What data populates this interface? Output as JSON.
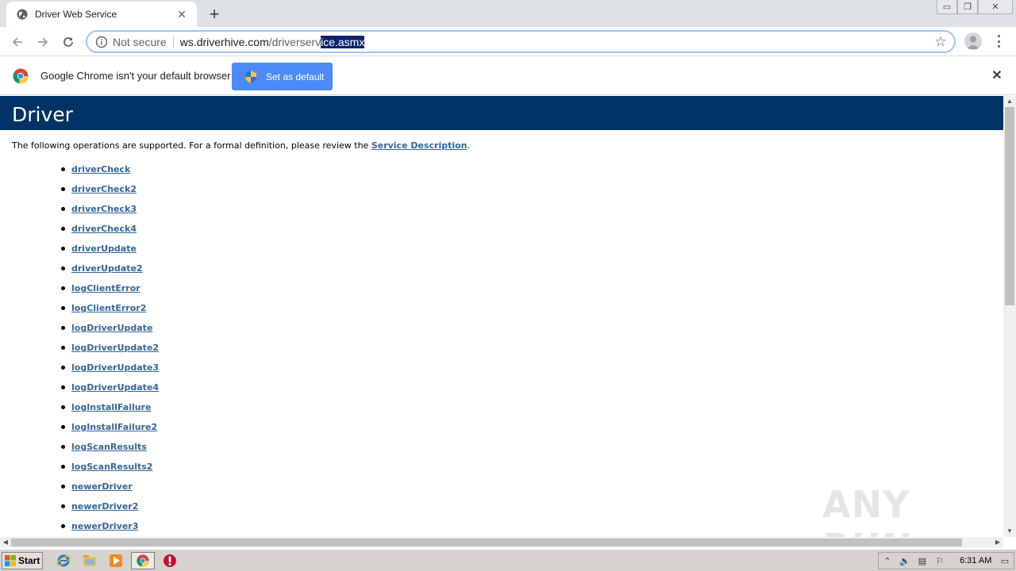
{
  "browser": {
    "tab": {
      "title": "Driver Web Service"
    },
    "omnibox": {
      "security_label": "Not secure",
      "url_host": "ws.driverhive.com",
      "url_path": "/driverserv",
      "url_selected": "ice.asmx"
    },
    "infobar": {
      "message": "Google Chrome isn't your default browser",
      "button_label": "Set as default"
    }
  },
  "page": {
    "heading": "Driver",
    "intro_prefix": "The following operations are supported. For a formal definition, please review the ",
    "intro_link": "Service Description",
    "intro_suffix": ".",
    "operations": [
      "driverCheck",
      "driverCheck2",
      "driverCheck3",
      "driverCheck4",
      "driverUpdate",
      "driverUpdate2",
      "logClientError",
      "logClientError2",
      "logDriverUpdate",
      "logDriverUpdate2",
      "logDriverUpdate3",
      "logDriverUpdate4",
      "logInstallFailure",
      "logInstallFailure2",
      "logScanResults",
      "logScanResults2",
      "newerDriver",
      "newerDriver2",
      "newerDriver3"
    ],
    "watermark": "ANY RUN"
  },
  "taskbar": {
    "start_label": "Start",
    "clock": "6:31 AM",
    "icons": [
      "ie-icon",
      "explorer-icon",
      "media-player-icon",
      "chrome-icon",
      "antivirus-icon"
    ]
  },
  "colors": {
    "heading_bg": "#003366",
    "link": "#336699",
    "button": "#4c8bf5",
    "selection": "#0c246a"
  }
}
